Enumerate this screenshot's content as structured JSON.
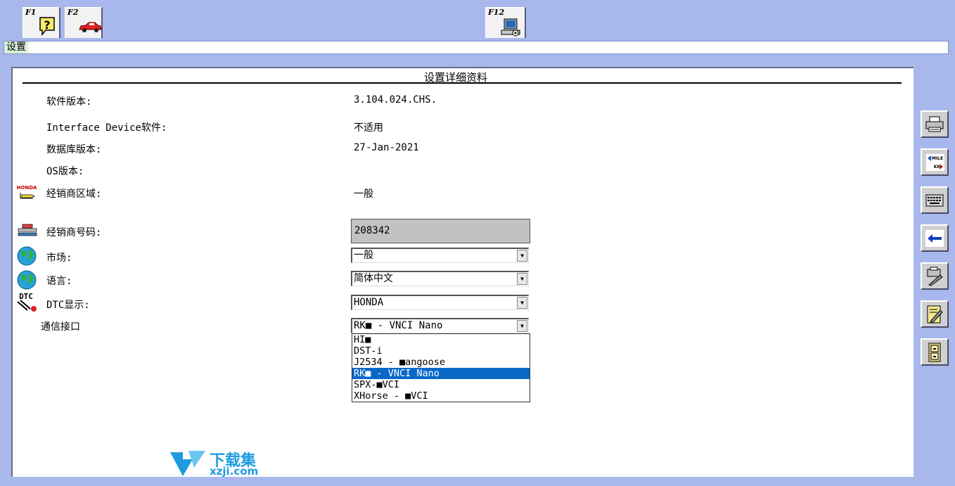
{
  "fkeys": [
    {
      "label": "F1",
      "icon": "help-question-icon"
    },
    {
      "label": "F2",
      "icon": "car-icon"
    },
    {
      "label": "F12",
      "icon": "computer-settings-icon"
    }
  ],
  "window": {
    "title": "设置"
  },
  "panel": {
    "title": "设置详细资料",
    "rows": {
      "software_version": {
        "label": "软件版本:",
        "value": "3.104.024.CHS."
      },
      "interface_device": {
        "label": "Interface Device软件:",
        "value": "不适用"
      },
      "database_version": {
        "label": "数据库版本:",
        "value": "27-Jan-2021"
      },
      "os_version": {
        "label": "OS版本:",
        "value": ""
      },
      "dealer_region": {
        "label": "经销商区域:",
        "value": "一般",
        "icon_text": "HONDA"
      },
      "dealer_number": {
        "label": "经销商号码:",
        "value": "208342"
      },
      "market": {
        "label": "市场:",
        "value": "一般"
      },
      "language": {
        "label": "语言:",
        "value": "简体中文"
      },
      "dtc_display": {
        "label": "DTC显示:",
        "value": "HONDA",
        "icon_text": "DTC"
      },
      "comm_interface": {
        "label": "通信接口",
        "value": "RK■ - VNCI Nano"
      }
    },
    "dropdown_options": [
      "HI■",
      "DST-i",
      "J2534 - ■angoose",
      "RK■ - VNCI Nano",
      "SPX-■VCI",
      "XHorse - ■VCI"
    ],
    "dropdown_selected_index": 3
  },
  "sidebar": {
    "buttons": [
      {
        "icon": "printer-icon"
      },
      {
        "icon": "mile-km-convert-icon",
        "text_top": "MILE",
        "text_bottom": "KM"
      },
      {
        "icon": "keyboard-icon"
      },
      {
        "icon": "back-arrow-icon"
      },
      {
        "icon": "print-settings-icon"
      },
      {
        "icon": "edit-document-icon"
      },
      {
        "icon": "file-cabinet-icon"
      }
    ]
  },
  "watermark": {
    "cn": "下载集",
    "en": "xzji.com"
  },
  "colors": {
    "background": "#a9b8ec",
    "selected": "#0a68c8",
    "watermark": "#1e9be0"
  }
}
